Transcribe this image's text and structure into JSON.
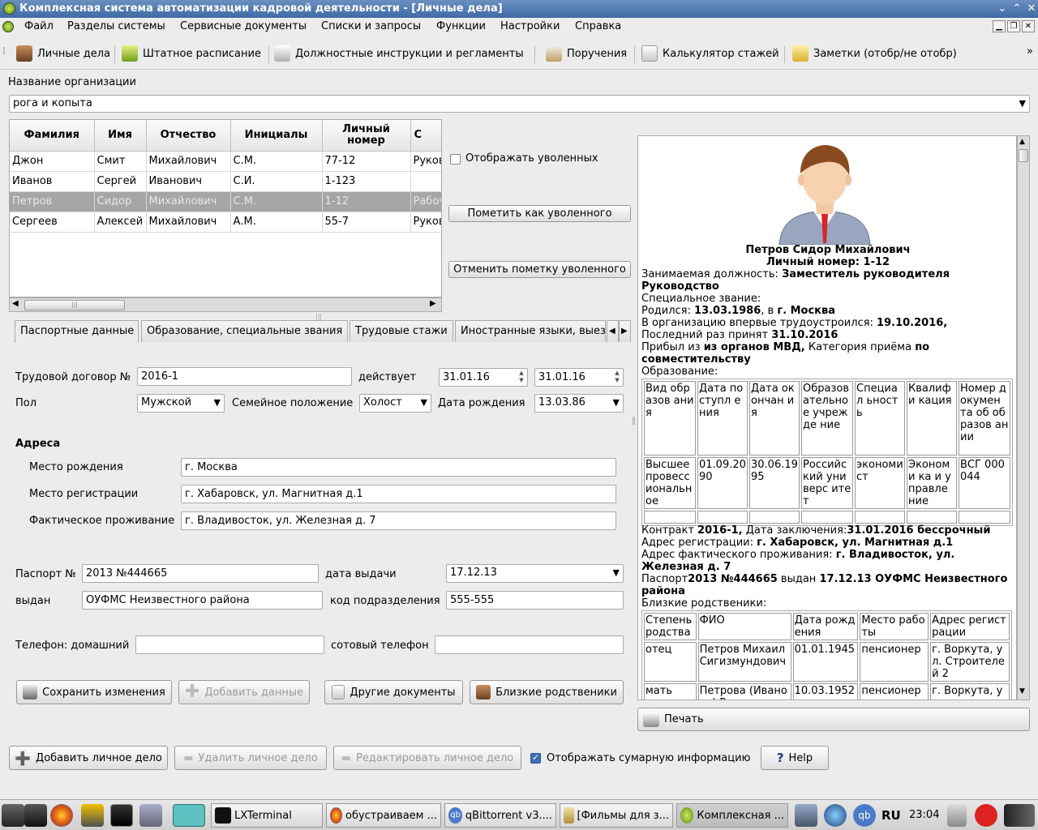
{
  "window": {
    "title": "Комплексная система автоматизации кадровой деятельности - [Личные дела]",
    "controls": [
      "⌄",
      "⌃",
      "✕"
    ]
  },
  "menu": {
    "items": [
      "Файл",
      "Разделы системы",
      "Сервисные документы",
      "Списки и запросы",
      "Функции",
      "Настройки",
      "Справка"
    ],
    "mdi_controls": [
      "▁",
      "❐",
      "✕"
    ]
  },
  "toolbar": {
    "items": [
      "Личные дела",
      "Штатное расписание",
      "Должностные инструкции и регламенты",
      "Поручения",
      "Калькулятор стажей",
      "Заметки (отобр/не отобр)"
    ],
    "overflow": "»",
    "grip": "⁞"
  },
  "org": {
    "label": "Название организации",
    "value": "рога и копыта",
    "arrow": "▼"
  },
  "employees": {
    "headers": [
      "Фамилия",
      "Имя",
      "Отчество",
      "Инициалы",
      "Личный номер",
      "С"
    ],
    "rows": [
      [
        "Джон",
        "Смит",
        "Михайлович",
        "С.М.",
        "77-12",
        "Руков"
      ],
      [
        "Иванов",
        "Сергей",
        "Иванович",
        "С.И.",
        "1-123",
        ""
      ],
      [
        "Петров",
        "Сидор",
        "Михайлович",
        "С.М.",
        "1-12",
        "Рабоч"
      ],
      [
        "Сергеев",
        "Алексей",
        "Михайлович",
        "А.М.",
        "55-7",
        "Руков"
      ]
    ],
    "scroll": {
      "left": "◀",
      "right": "▶",
      "grip": "|||"
    }
  },
  "side_controls": {
    "show_fired": "Отображать уволенных",
    "mark_fired": "Пометить как уволенного",
    "unmark_fired": "Отменить пометку уволенного"
  },
  "tabs": {
    "items": [
      "Паспортные данные",
      "Образование, специальные звания",
      "Трудовые стажи",
      "Иностранные языки, выезд"
    ],
    "nav_left": "◀",
    "nav_right": "▶"
  },
  "form": {
    "contract_label": "Трудовой договор №",
    "contract_value": "2016-1",
    "valid_label": "действует",
    "valid_from": "31.01.16",
    "valid_to": "31.01.16",
    "sex_label": "Пол",
    "sex_value": "Мужской",
    "marital_label": "Семейное положение",
    "marital_value": "Холост",
    "birth_label": "Дата рождения",
    "birth_value": "13.03.86",
    "addresses_title": "Адреса",
    "birth_place_label": "Место рождения",
    "birth_place_value": "г. Москва",
    "reg_label": "Место регистрации",
    "reg_value": "г. Хабаровск, ул. Магнитная д.1",
    "actual_label": "Фактическое проживание",
    "actual_value": "г. Владивосток, ул. Железная д. 7",
    "passport_label": "Паспорт №",
    "passport_value": "2013 №444665",
    "issue_date_label": "дата выдачи",
    "issue_date_value": "17.12.13",
    "issued_by_label": "выдан",
    "issued_by_value": "ОУФМС Неизвестного района",
    "dept_code_label": "код подразделения",
    "dept_code_value": "555-555",
    "home_phone_label": "Телефон: домашний",
    "home_phone_value": "",
    "mobile_label": "сотовый телефон",
    "mobile_value": ""
  },
  "form_buttons": {
    "save": "Сохранить изменения",
    "add": "Добавить данные",
    "other_docs": "Другие документы",
    "relatives": "Близкие родственики"
  },
  "info": {
    "name": "Петров Сидор  Михайлович",
    "personal_no": "Личный номер: 1-12",
    "position_label": "Занимаемая должность: ",
    "position_value": "Заместитель руководителя",
    "department": "Руководство",
    "special_rank_label": "Специальное звание:",
    "born_label": "Родился: ",
    "born_date": "13.03.1986",
    "born_in": ", в ",
    "born_city": "г. Москва",
    "first_hired_label": " В организацию впервые трудоустроился: ",
    "first_hired_value": "19.10.2016,",
    "last_hired_label": "Последний раз принят ",
    "last_hired_value": "31.10.2016",
    "arrived_label": " Прибыл из ",
    "arrived_value": "из органов МВД,",
    "category_label": " Категория приёма ",
    "category_value": "по",
    "category_value2": "совместительству",
    "education_label": " Образование:",
    "education_headers": [
      "Вид образов ания",
      "Дата поступл ения",
      "Дата окончан ия",
      "Образов ательно е учрежде ние",
      "Специал ьность",
      "Квалифи кация",
      "Номер докумен та об образов ании"
    ],
    "education_rows": [
      [
        "Высшее провесс иональн ое",
        "01.09.20 90",
        "30.06.19 95",
        "Российс кий универс итет",
        "экономи ст",
        "Экономи ка и управле ние",
        "ВСГ 000044"
      ]
    ],
    "contract_label": "Контракт ",
    "contract_value": "2016-1,",
    "contract_date_label": " Дата заключения:",
    "contract_date_value": "31.01.2016 бессрочный",
    "reg_addr_label": " Адрес регистрации: ",
    "reg_addr_value": "г. Хабаровск, ул. Магнитная д.1",
    "act_addr_label": " Адрес фактического проживания: ",
    "act_addr_value": "г. Владивосток, ул.",
    "act_addr_value2": "Железная д. 7",
    "passport_label": "Паспорт",
    "passport_value": "2013 №444665",
    "issued_label": " выдан ",
    "issued_date": "17.12.13",
    "issued_by": "  ОУФМС Неизвестного",
    "issued_by2": "района",
    "relatives_label": "Близкие родственики:",
    "relatives_headers": [
      "Степень родства",
      "ФИО",
      "Дата рождения",
      "Место работы",
      "Адрес регистрации"
    ],
    "relatives_rows": [
      [
        "отец",
        "Петров Михаил Сигизмундович",
        "01.01.1945",
        "пенсионер",
        "г. Воркута, ул. Строителей 2"
      ],
      [
        "мать",
        "Петрова (Иванова) Раиса",
        "10.03.1952",
        "пенсионер",
        "г. Воркута, ул."
      ]
    ],
    "scroll_up": "▲",
    "scroll_down": "▼"
  },
  "print_button": "Печать",
  "bottom_buttons": {
    "add": "Добавить личное дело",
    "delete": "Удалить личное дело",
    "edit": "Редактировать личное дело",
    "show_summary": "Отображать сумарную информацию",
    "help": "Help",
    "help_icon": "?"
  },
  "taskbar": {
    "tasks": [
      "LXTerminal",
      "обустраиваем ...",
      "qBittorrent v3....",
      "[Фильмы для з...",
      "Комплексная ..."
    ],
    "lang": "RU",
    "time": "23:04",
    "qbit_glyph": "qb"
  }
}
